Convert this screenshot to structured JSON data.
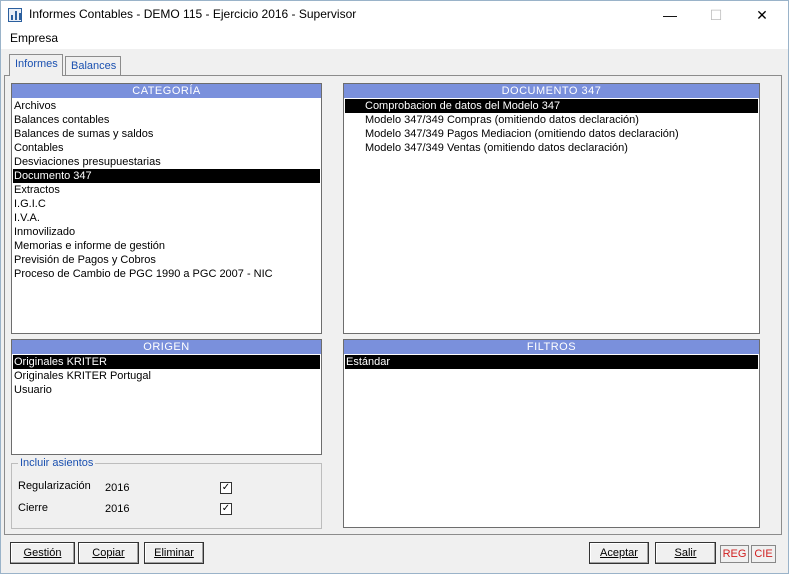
{
  "window": {
    "title": "Informes Contables - DEMO 115 - Ejercicio 2016 - Supervisor",
    "minimize_glyph": "—",
    "maximize_glyph": "☐",
    "close_glyph": "✕"
  },
  "menu": {
    "items": [
      "Empresa"
    ]
  },
  "tabs": [
    {
      "label": "Informes",
      "active": true
    },
    {
      "label": "Balances",
      "active": false
    }
  ],
  "categoria": {
    "header": "CATEGORÍA",
    "items": [
      "Archivos",
      "Balances contables",
      "Balances de sumas y saldos",
      "Contables",
      "Desviaciones presupuestarias",
      "Documento 347",
      "Extractos",
      "I.G.I.C",
      "I.V.A.",
      "Inmovilizado",
      "Memorias e informe de gestión",
      "Previsión de Pagos y Cobros",
      "Proceso de Cambio de PGC 1990 a PGC 2007 - NIC"
    ],
    "selected": 5
  },
  "documento": {
    "header": "DOCUMENTO 347",
    "items": [
      "Comprobacion de datos del Modelo 347",
      "Modelo 347/349 Compras (omitiendo datos declaración)",
      "Modelo 347/349 Pagos Mediacion (omitiendo datos declaración)",
      "Modelo 347/349 Ventas (omitiendo datos declaración)"
    ],
    "selected": 0
  },
  "origen": {
    "header": "ORIGEN",
    "items": [
      "Originales KRITER",
      "Originales KRITER Portugal",
      "Usuario"
    ],
    "selected": 0
  },
  "filtros": {
    "header": "FILTROS",
    "items": [
      "Estándar"
    ],
    "selected": 0
  },
  "incluir": {
    "legend": "Incluir asientos",
    "rows": [
      {
        "label": "Regularización",
        "year": "2016",
        "checked": true
      },
      {
        "label": "Cierre",
        "year": "2016",
        "checked": true
      }
    ],
    "check_glyph": "✓"
  },
  "buttons": {
    "gestion": "Gestión",
    "copiar": "Copiar",
    "eliminar": "Eliminar",
    "aceptar": "Aceptar",
    "salir": "Salir"
  },
  "status": {
    "reg": "REG",
    "cie": "CIE",
    "color": "#d02020"
  }
}
